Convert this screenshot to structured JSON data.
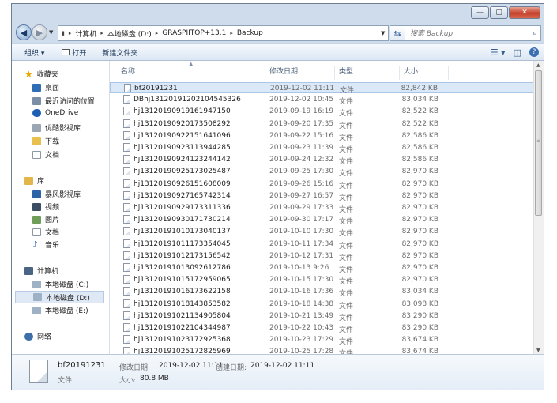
{
  "window": {
    "controls": {
      "minimize": "—",
      "maximize": "▢",
      "close": "✕"
    }
  },
  "nav": {
    "back": "◀",
    "forward": "▶",
    "path": [
      "计算机",
      "本地磁盘 (D:)",
      "GRASPIITOP+13.1",
      "Backup"
    ],
    "search_placeholder": "搜索 Backup"
  },
  "toolbar": {
    "organize": "组织 ▾",
    "open": "打开",
    "new_folder": "新建文件夹"
  },
  "sidebar": {
    "favorites": "收藏夹",
    "fav_items": [
      "桌面",
      "最近访问的位置",
      "OneDrive",
      "优酷影视库",
      "下载",
      "文档"
    ],
    "libraries": "库",
    "lib_items": [
      "暴风影视库",
      "视频",
      "图片",
      "文档",
      "音乐"
    ],
    "computer": "计算机",
    "drives": [
      "本地磁盘 (C:)",
      "本地磁盘 (D:)",
      "本地磁盘 (E:)"
    ],
    "network": "网络"
  },
  "columns": {
    "name": "名称",
    "date": "修改日期",
    "type": "类型",
    "size": "大小"
  },
  "files": [
    {
      "name": "bf20191231",
      "date": "2019-12-02 11:11",
      "type": "文件",
      "size": "82,842 KB",
      "selected": true
    },
    {
      "name": "DBhj131201912021045453​26",
      "date": "2019-12-02 10:45",
      "type": "文件",
      "size": "83,034 KB"
    },
    {
      "name": "hj131201909191619471​50",
      "date": "2019-09-19 16:19",
      "type": "文件",
      "size": "82,522 KB"
    },
    {
      "name": "hj131201909201735082​92",
      "date": "2019-09-20 17:35",
      "type": "文件",
      "size": "82,522 KB"
    },
    {
      "name": "hj131201909221516410​96",
      "date": "2019-09-22 15:16",
      "type": "文件",
      "size": "82,586 KB"
    },
    {
      "name": "hj131201909231139442​85",
      "date": "2019-09-23 11:39",
      "type": "文件",
      "size": "82,586 KB"
    },
    {
      "name": "hj131201909241232441​42",
      "date": "2019-09-24 12:32",
      "type": "文件",
      "size": "82,586 KB"
    },
    {
      "name": "hj131201909251730254​87",
      "date": "2019-09-25 17:30",
      "type": "文件",
      "size": "82,970 KB"
    },
    {
      "name": "hj131201909261516080​09",
      "date": "2019-09-26 15:16",
      "type": "文件",
      "size": "82,970 KB"
    },
    {
      "name": "hj131201909271657423​14",
      "date": "2019-09-27 16:57",
      "type": "文件",
      "size": "82,970 KB"
    },
    {
      "name": "hj131201909291733113​36",
      "date": "2019-09-29 17:33",
      "type": "文件",
      "size": "82,970 KB"
    },
    {
      "name": "hj131201909301717302​14",
      "date": "2019-09-30 17:17",
      "type": "文件",
      "size": "82,970 KB"
    },
    {
      "name": "hj131201910101730401​37",
      "date": "2019-10-10 17:30",
      "type": "文件",
      "size": "82,970 KB"
    },
    {
      "name": "hj131201910111733540​45",
      "date": "2019-10-11 17:34",
      "type": "文件",
      "size": "82,970 KB"
    },
    {
      "name": "hj131201910121731565​42",
      "date": "2019-10-12 17:31",
      "type": "文件",
      "size": "82,970 KB"
    },
    {
      "name": "hj131201910130926127​86",
      "date": "2019-10-13 9:26",
      "type": "文件",
      "size": "82,970 KB"
    },
    {
      "name": "hj131201910151729590​65",
      "date": "2019-10-15 17:30",
      "type": "文件",
      "size": "82,970 KB"
    },
    {
      "name": "hj131201910161736221​58",
      "date": "2019-10-16 17:36",
      "type": "文件",
      "size": "83,034 KB"
    },
    {
      "name": "hj131201910181438535​82",
      "date": "2019-10-18 14:38",
      "type": "文件",
      "size": "83,098 KB"
    },
    {
      "name": "hj131201910211349058​04",
      "date": "2019-10-21 13:49",
      "type": "文件",
      "size": "83,290 KB"
    },
    {
      "name": "hj131201910221043449​87",
      "date": "2019-10-22 10:43",
      "type": "文件",
      "size": "83,290 KB"
    },
    {
      "name": "hj131201910231729253​68",
      "date": "2019-10-23 17:29",
      "type": "文件",
      "size": "83,674 KB"
    },
    {
      "name": "hj131201910251728259​69",
      "date": "2019-10-25 17:28",
      "type": "文件",
      "size": "83,674 KB"
    }
  ],
  "details": {
    "name": "bf20191231",
    "modified_label": "修改日期:",
    "modified": "2019-12-02 11:11",
    "created_label": "创建日期:",
    "created": "2019-12-02 11:11",
    "type": "文件",
    "size_label": "大小:",
    "size": "80.8 MB"
  },
  "colors": {
    "selection": "#dbe8f7",
    "frame": "#cfdceb",
    "close": "#c5402a"
  }
}
